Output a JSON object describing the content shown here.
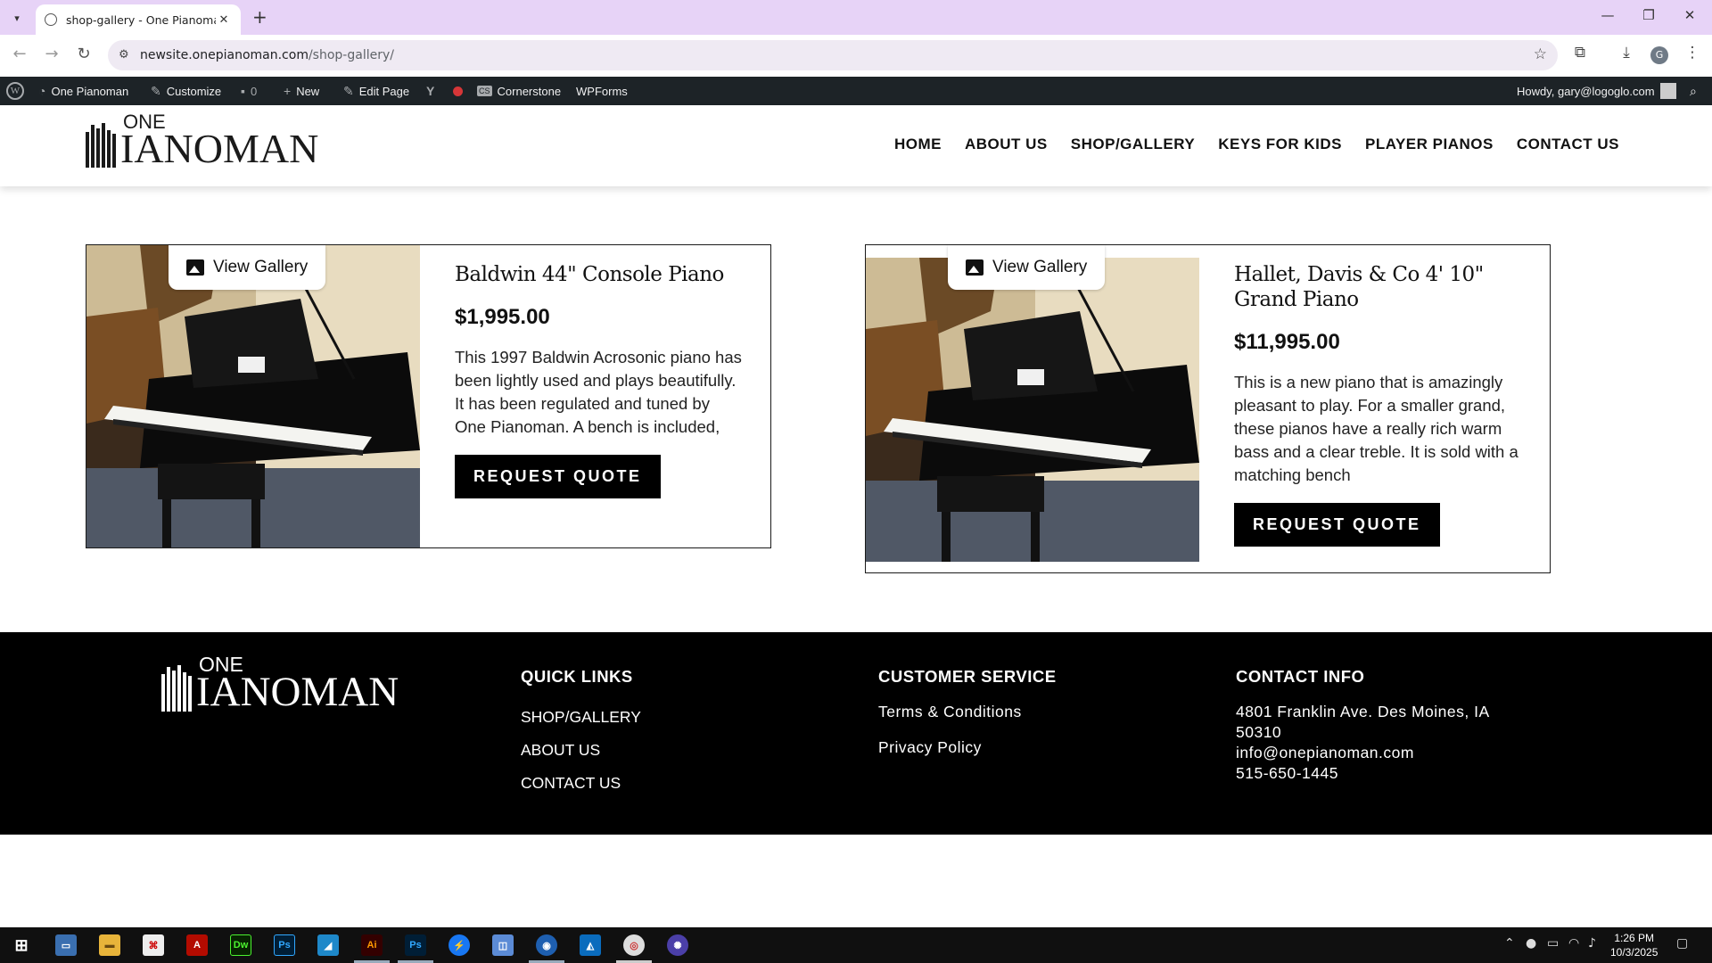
{
  "browser": {
    "tab_title": "shop-gallery - One Pianoman",
    "url_host": "newsite.onepianoman.com",
    "url_path": "/shop-gallery/"
  },
  "wp_admin": {
    "site_name": "One Pianoman",
    "customize": "Customize",
    "comments": "0",
    "new": "New",
    "edit_page": "Edit Page",
    "cornerstone": "Cornerstone",
    "wpforms": "WPForms",
    "howdy": "Howdy, gary@logoglo.com"
  },
  "logo": {
    "top": "ONE",
    "bottom": "IANOMAN"
  },
  "nav": [
    "HOME",
    "ABOUT US",
    "SHOP/GALLERY",
    "KEYS FOR KIDS",
    "PLAYER PIANOS",
    "CONTACT US"
  ],
  "products": [
    {
      "gallery_label": "View Gallery",
      "title": "Baldwin 44\" Console Piano",
      "price": "$1,995.00",
      "description": "This 1997 Baldwin Acrosonic piano has been lightly used and plays beautifully. It has been regulated and tuned by One Pianoman. A bench is included,",
      "button": "REQUEST QUOTE"
    },
    {
      "gallery_label": "View Gallery",
      "title": "Hallet, Davis & Co 4' 10\" Grand Piano",
      "price": "$11,995.00",
      "description": "This is a new piano that is amazingly pleasant to play. For a smaller grand, these pianos have a really rich warm bass and a clear treble. It is sold with a matching bench",
      "button": "REQUEST QUOTE"
    }
  ],
  "footer": {
    "quick_links_title": "QUICK LINKS",
    "quick_links": [
      "SHOP/GALLERY",
      "ABOUT US",
      "CONTACT US"
    ],
    "customer_service_title": "CUSTOMER SERVICE",
    "customer_service": [
      "Terms & Conditions",
      "Privacy Policy"
    ],
    "contact_title": "CONTACT INFO",
    "address": "4801 Franklin Ave. Des Moines, IA 50310",
    "email": "info@onepianoman.com",
    "phone": "515-650-1445"
  },
  "taskbar": {
    "time": "1:26 PM",
    "date": "10/3/2025",
    "apps": [
      "Dw",
      "Ps",
      "Ai",
      "Ps"
    ]
  },
  "colors": {
    "tab_strip": "#e7d3f7",
    "wp_admin_bar": "#1d2327",
    "footer_bg": "#000000",
    "button_bg": "#000000"
  }
}
